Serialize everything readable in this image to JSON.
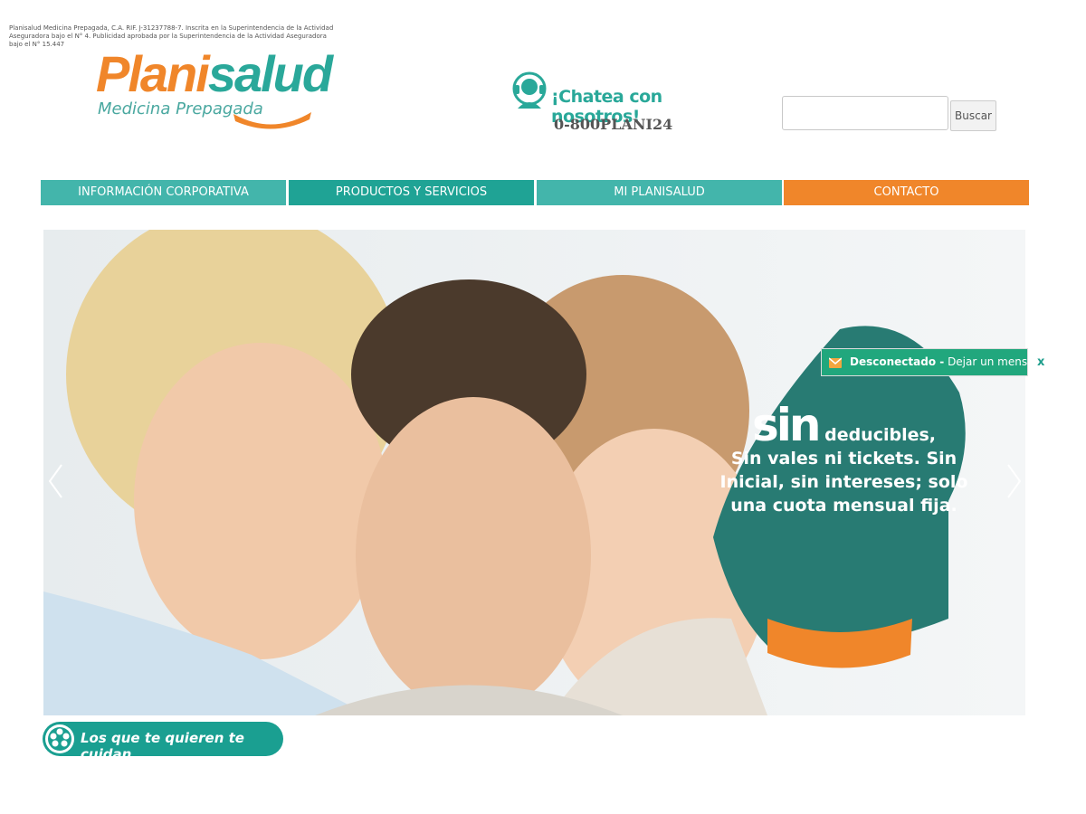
{
  "legal_text": "Planisalud Medicina Prepagada, C.A. RIF. J-31237788-7. Inscrita en la Superintendencia de la Actividad Aseguradora bajo el N° 4. Publicidad aprobada por la Superintendencia de la Actividad Aseguradora bajo el N° 15.447",
  "logo": {
    "part1": "Plani",
    "part2": "salud",
    "subtitle": "Medicina Prepagada"
  },
  "chat": {
    "title": "¡Chatea con nosotros!",
    "phone": "0-800PLANI24"
  },
  "search": {
    "value": "",
    "button": "Buscar"
  },
  "nav": [
    {
      "label": "INFORMACIÓN CORPORATIVA",
      "color": "#43b5ab"
    },
    {
      "label": "PRODUCTOS Y SERVICIOS",
      "color": "#1fa395"
    },
    {
      "label": "MI PLANISALUD",
      "color": "#43b5ab"
    },
    {
      "label": "CONTACTO",
      "color": "#f0862a"
    }
  ],
  "hero": {
    "headline_big": "sin",
    "headline_rest": "deducibles,",
    "body": "Sin vales ni tickets. Sin Inicial, sin intereses; solo una cuota mensual fija."
  },
  "slogan": "Los que te quieren te cuidan",
  "chat_widget": {
    "status": "Desconectado -",
    "action": "Dejar un mensaje",
    "close": "x"
  },
  "colors": {
    "teal": "#2aa89a",
    "orange": "#f0862a",
    "dark_teal": "#1a9f91"
  }
}
